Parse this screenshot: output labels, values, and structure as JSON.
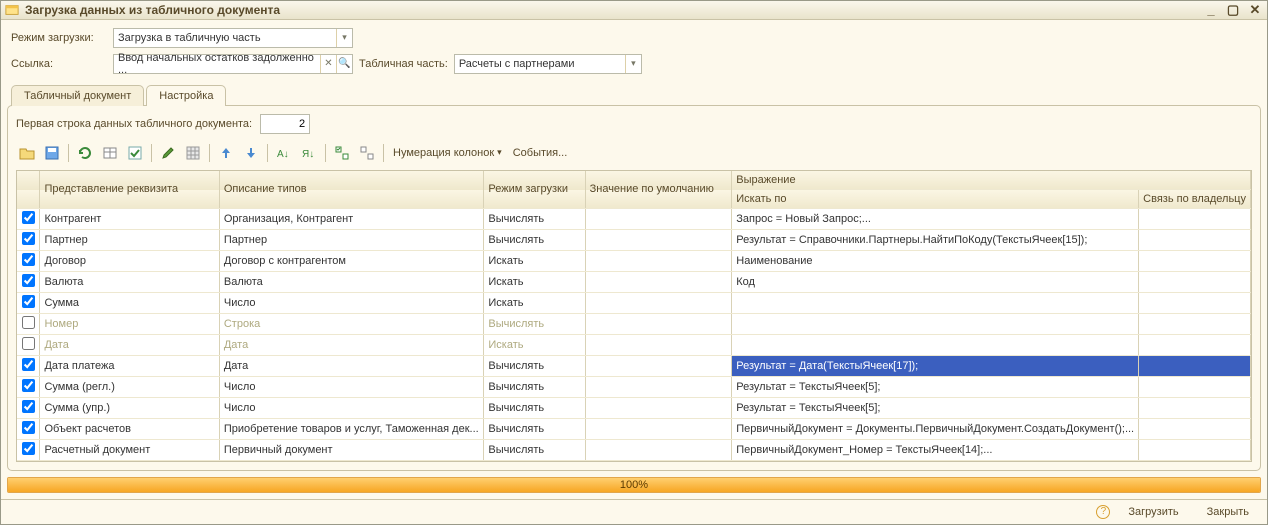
{
  "window": {
    "title": "Загрузка данных из табличного документа"
  },
  "form": {
    "mode_label": "Режим загрузки:",
    "mode_value": "Загрузка в табличную часть",
    "ref_label": "Ссылка:",
    "ref_value": "Ввод начальных остатков задолженно ...",
    "tabpart_label": "Табличная часть:",
    "tabpart_value": "Расчеты с партнерами"
  },
  "tabs": {
    "tab1": "Табличный документ",
    "tab2": "Настройка",
    "active": 2
  },
  "first_row": {
    "label": "Первая строка данных табличного документа:",
    "value": "2"
  },
  "toolbar": {
    "numbering_label": "Нумерация колонок",
    "events_label": "События..."
  },
  "columns": {
    "chk": "",
    "repr": "Представление реквизита",
    "types": "Описание типов",
    "mode": "Режим загрузки",
    "default": "Значение по умолчанию",
    "expr": "Выражение",
    "search": "Искать по",
    "link": "Связь по владельцу"
  },
  "rows": [
    {
      "chk": true,
      "repr": "Контрагент",
      "types": "Организация, Контрагент",
      "mode": "Вычислять",
      "default": "",
      "search": "Запрос = Новый Запрос;...",
      "link": "",
      "disabled": false,
      "selected": false
    },
    {
      "chk": true,
      "repr": "Партнер",
      "types": "Партнер",
      "mode": "Вычислять",
      "default": "",
      "search": "Результат = Справочники.Партнеры.НайтиПоКоду(ТекстыЯчеек[15]);",
      "link": "",
      "disabled": false,
      "selected": false
    },
    {
      "chk": true,
      "repr": "Договор",
      "types": "Договор с контрагентом",
      "mode": "Искать",
      "default": "",
      "search": "Наименование",
      "link": "",
      "disabled": false,
      "selected": false
    },
    {
      "chk": true,
      "repr": "Валюта",
      "types": "Валюта",
      "mode": "Искать",
      "default": "",
      "search": "Код",
      "link": "",
      "disabled": false,
      "selected": false
    },
    {
      "chk": true,
      "repr": "Сумма",
      "types": "Число",
      "mode": "Искать",
      "default": "",
      "search": "",
      "link": "",
      "disabled": false,
      "selected": false
    },
    {
      "chk": false,
      "repr": "Номер",
      "types": "Строка",
      "mode": "Вычислять",
      "default": "",
      "search": "",
      "link": "",
      "disabled": true,
      "selected": false
    },
    {
      "chk": false,
      "repr": "Дата",
      "types": "Дата",
      "mode": "Искать",
      "default": "",
      "search": "",
      "link": "",
      "disabled": true,
      "selected": false
    },
    {
      "chk": true,
      "repr": "Дата платежа",
      "types": "Дата",
      "mode": "Вычислять",
      "default": "",
      "search": "Результат          = Дата(ТекстыЯчеек[17]);",
      "link": "",
      "disabled": false,
      "selected": true
    },
    {
      "chk": true,
      "repr": "Сумма (регл.)",
      "types": "Число",
      "mode": "Вычислять",
      "default": "",
      "search": "Результат =  ТекстыЯчеек[5];",
      "link": "",
      "disabled": false,
      "selected": false
    },
    {
      "chk": true,
      "repr": "Сумма (упр.)",
      "types": "Число",
      "mode": "Вычислять",
      "default": "",
      "search": "Результат =  ТекстыЯчеек[5];",
      "link": "",
      "disabled": false,
      "selected": false
    },
    {
      "chk": true,
      "repr": "Объект расчетов",
      "types": "Приобретение товаров и услуг, Таможенная дек...",
      "mode": "Вычислять",
      "default": "",
      "search": "ПервичныйДокумент = Документы.ПервичныйДокумент.СоздатьДокумент();...",
      "link": "",
      "disabled": false,
      "selected": false
    },
    {
      "chk": true,
      "repr": "Расчетный документ",
      "types": "Первичный документ",
      "mode": "Вычислять",
      "default": "",
      "search": "ПервичныйДокумент_Номер = ТекстыЯчеек[14];...",
      "link": "",
      "disabled": false,
      "selected": false
    }
  ],
  "progress": {
    "value": 100,
    "label": "100%"
  },
  "footer": {
    "help_tooltip": "?",
    "load_label": "Загрузить",
    "close_label": "Закрыть"
  }
}
